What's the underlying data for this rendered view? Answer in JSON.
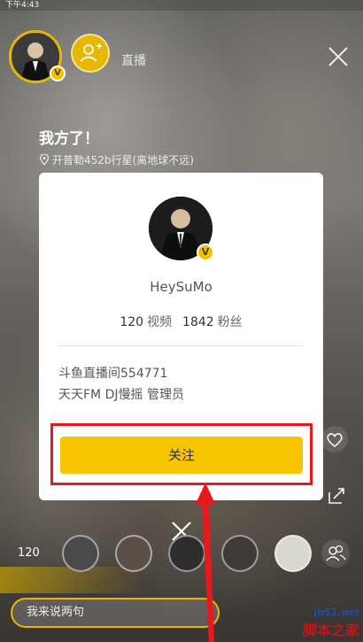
{
  "status_bar": {
    "time": "下午4:43"
  },
  "host": {
    "badge": "V",
    "tag": "直播"
  },
  "stream": {
    "title": "我方了！",
    "location": "开普勒452b行星(离地球不远)"
  },
  "profile_card": {
    "badge": "V",
    "username": "HeySuMo",
    "videos_count": "120",
    "videos_label": "视频",
    "fans_count": "1842",
    "fans_label": "粉丝",
    "info_line_1": "斗鱼直播间554771",
    "info_line_2": "天天FM DJ慢摇 管理员",
    "follow_button": "关注"
  },
  "viewers": {
    "count": "120"
  },
  "chat": {
    "placeholder": "我来说两句"
  },
  "watermark": {
    "url": "jb51.net",
    "name": "脚本之家"
  },
  "colors": {
    "accent_yellow": "#f7c500",
    "highlight_red": "#e8191c"
  },
  "icons": [
    "add-user-icon",
    "close-icon",
    "location-pin-icon",
    "heart-icon",
    "share-icon",
    "viewers-icon"
  ]
}
